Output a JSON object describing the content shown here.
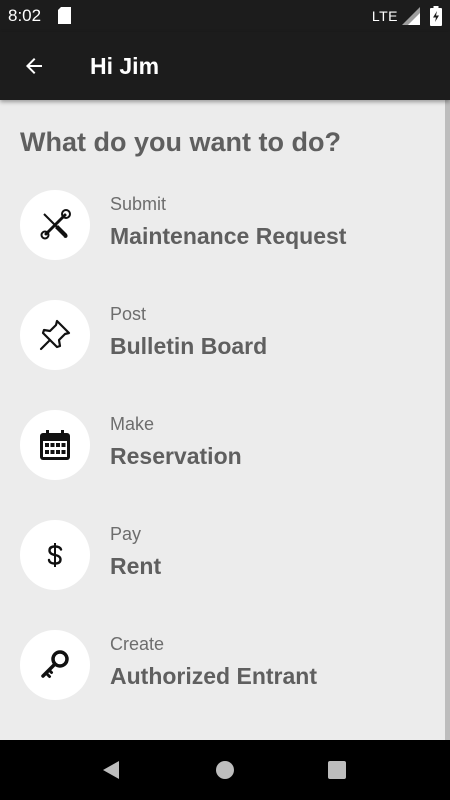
{
  "status_bar": {
    "time": "8:02",
    "network": "LTE"
  },
  "app_bar": {
    "title": "Hi Jim",
    "back_icon": "arrow-left-icon"
  },
  "main": {
    "heading": "What do you want to do?",
    "items": [
      {
        "action": "Submit",
        "label": "Maintenance Request",
        "icon": "tools-icon"
      },
      {
        "action": "Post",
        "label": "Bulletin Board",
        "icon": "pushpin-icon"
      },
      {
        "action": "Make",
        "label": "Reservation",
        "icon": "calendar-icon"
      },
      {
        "action": "Pay",
        "label": "Rent",
        "icon": "dollar-icon"
      },
      {
        "action": "Create",
        "label": "Authorized Entrant",
        "icon": "key-icon"
      }
    ]
  },
  "nav_bar": {
    "buttons": [
      "back-triangle-icon",
      "home-circle-icon",
      "recents-square-icon"
    ]
  },
  "colors": {
    "app_bar_bg": "#1c1c1c",
    "content_bg": "#ececec",
    "heading_text": "#5f5f5f",
    "icon_circle_bg": "#ffffff"
  }
}
